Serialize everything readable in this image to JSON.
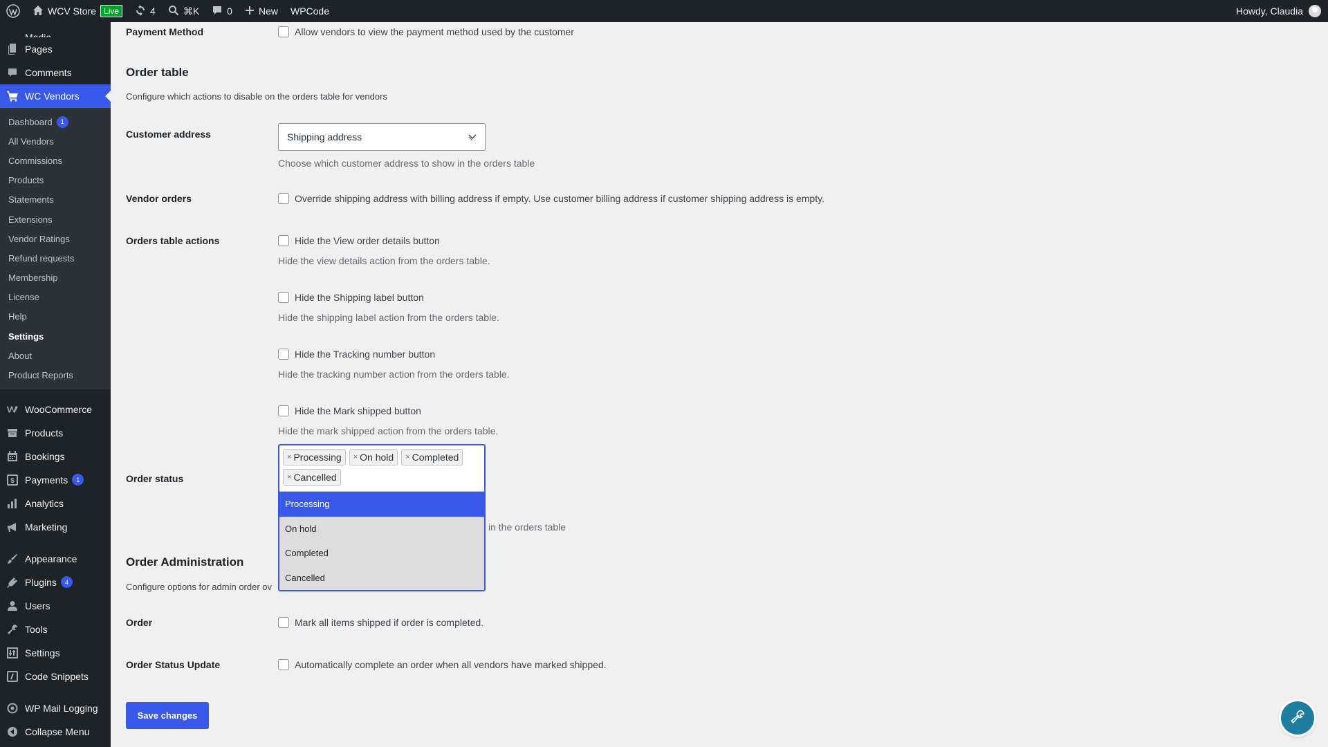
{
  "adminbar": {
    "site_name": "WCV Store",
    "live_badge": "Live",
    "updates_count": "4",
    "search_shortcut": "⌘K",
    "comments_count": "0",
    "new_label": "New",
    "wpcode_label": "WPCode",
    "howdy": "Howdy, Claudia"
  },
  "sidebar": {
    "partial_item": "Media",
    "pages": "Pages",
    "comments": "Comments",
    "wc_vendors": "WC Vendors",
    "submenu": [
      {
        "label": "Dashboard",
        "count": "1"
      },
      {
        "label": "All Vendors"
      },
      {
        "label": "Commissions"
      },
      {
        "label": "Products"
      },
      {
        "label": "Statements"
      },
      {
        "label": "Extensions"
      },
      {
        "label": "Vendor Ratings"
      },
      {
        "label": "Refund requests"
      },
      {
        "label": "Membership"
      },
      {
        "label": "License"
      },
      {
        "label": "Help"
      },
      {
        "label": "Settings"
      },
      {
        "label": "About"
      },
      {
        "label": "Product Reports"
      }
    ],
    "woocommerce": "WooCommerce",
    "products": "Products",
    "bookings": "Bookings",
    "payments": "Payments",
    "payments_count": "1",
    "analytics": "Analytics",
    "marketing": "Marketing",
    "appearance": "Appearance",
    "plugins": "Plugins",
    "plugins_count": "4",
    "users": "Users",
    "tools": "Tools",
    "settings": "Settings",
    "code_snippets": "Code Snippets",
    "wp_mail_logging": "WP Mail Logging",
    "collapse_menu": "Collapse Menu"
  },
  "settings": {
    "payment_method": {
      "label": "Payment Method",
      "checkbox": "Allow vendors to view the payment method used by the customer"
    },
    "order_table": {
      "title": "Order table",
      "description": "Configure which actions to disable on the orders table for vendors"
    },
    "customer_address": {
      "label": "Customer address",
      "value": "Shipping address",
      "description": "Choose which customer address to show in the orders table"
    },
    "vendor_orders": {
      "label": "Vendor orders",
      "checkbox": "Override shipping address with billing address if empty. Use customer billing address if customer shipping address is empty."
    },
    "orders_table_actions": {
      "label": "Orders table actions",
      "items": [
        {
          "checkbox": "Hide the View order details button",
          "description": "Hide the view details action from the orders table."
        },
        {
          "checkbox": "Hide the Shipping label button",
          "description": "Hide the shipping label action from the orders table."
        },
        {
          "checkbox": "Hide the Tracking number button",
          "description": "Hide the tracking number action from the orders table."
        },
        {
          "checkbox": "Hide the Mark shipped button",
          "description": "Hide the mark shipped action from the orders table."
        }
      ]
    },
    "order_status": {
      "label": "Order status",
      "selected": [
        "Processing",
        "On hold",
        "Completed",
        "Cancelled"
      ],
      "options": [
        "Processing",
        "On hold",
        "Completed",
        "Cancelled"
      ],
      "description_visible": "in the orders table"
    },
    "order_administration": {
      "title": "Order Administration",
      "description_visible": "Configure options for admin order ov"
    },
    "order": {
      "label": "Order",
      "checkbox": "Mark all items shipped if order is completed."
    },
    "order_status_update": {
      "label": "Order Status Update",
      "checkbox": "Automatically complete an order when all vendors have marked shipped."
    },
    "save_label": "Save changes"
  },
  "colors": {
    "accent": "#3858e9",
    "sidebar_bg": "#1d2327",
    "submenu_bg": "#2c3338",
    "help_fab": "#1e7ea1"
  }
}
